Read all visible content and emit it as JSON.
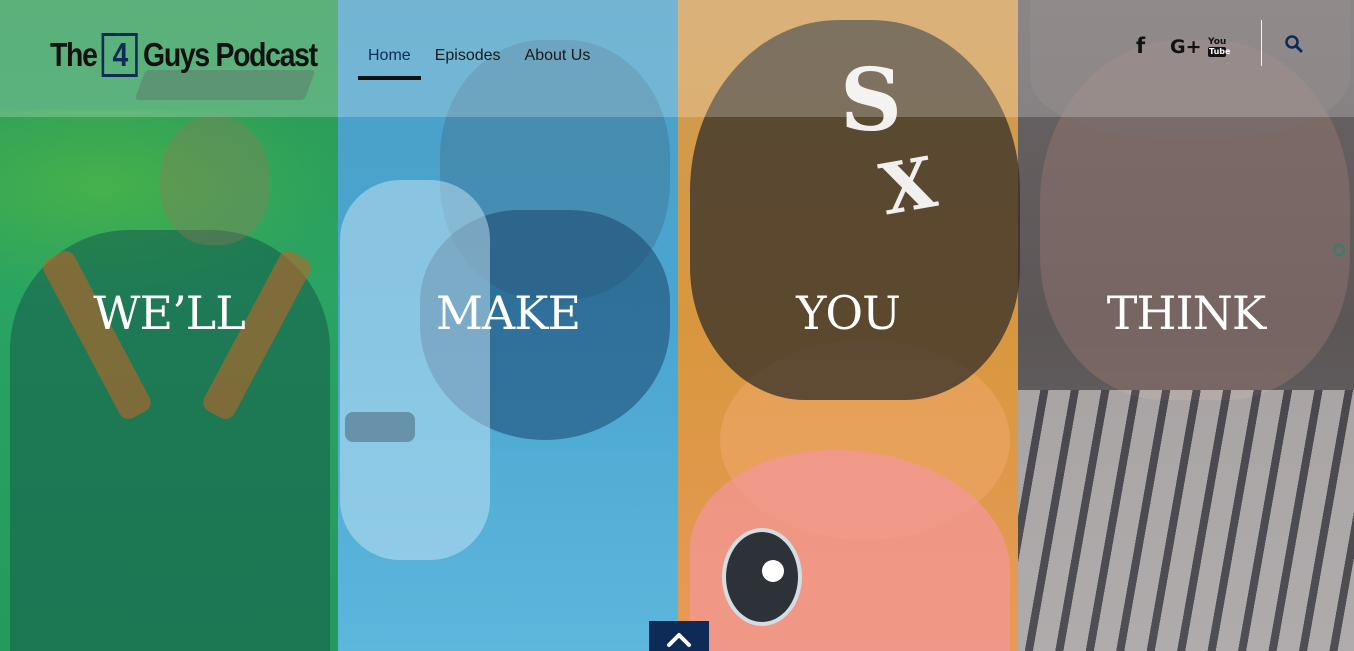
{
  "logo": {
    "text_before": "The",
    "number": "4",
    "text_after": "Guys Podcast"
  },
  "nav": {
    "items": [
      {
        "label": "Home",
        "active": true
      },
      {
        "label": "Episodes",
        "active": false
      },
      {
        "label": "About Us",
        "active": false
      }
    ]
  },
  "social": {
    "facebook": "f",
    "googleplus": "G+",
    "youtube_you": "You",
    "youtube_tube": "Tube",
    "icons": [
      "facebook-icon",
      "google-plus-icon",
      "youtube-icon"
    ]
  },
  "search": {
    "icon": "search-icon"
  },
  "hero": {
    "words": [
      "WE’LL",
      "MAKE",
      "YOU",
      "THINK"
    ]
  },
  "colors": {
    "brand_navy": "#0e2b58",
    "panel_green": "#2aa462",
    "panel_blue": "#4aa6d0",
    "panel_orange": "#d8973e",
    "panel_gray": "#5c5657"
  },
  "scroll_top": {
    "icon": "chevron-up-icon"
  }
}
